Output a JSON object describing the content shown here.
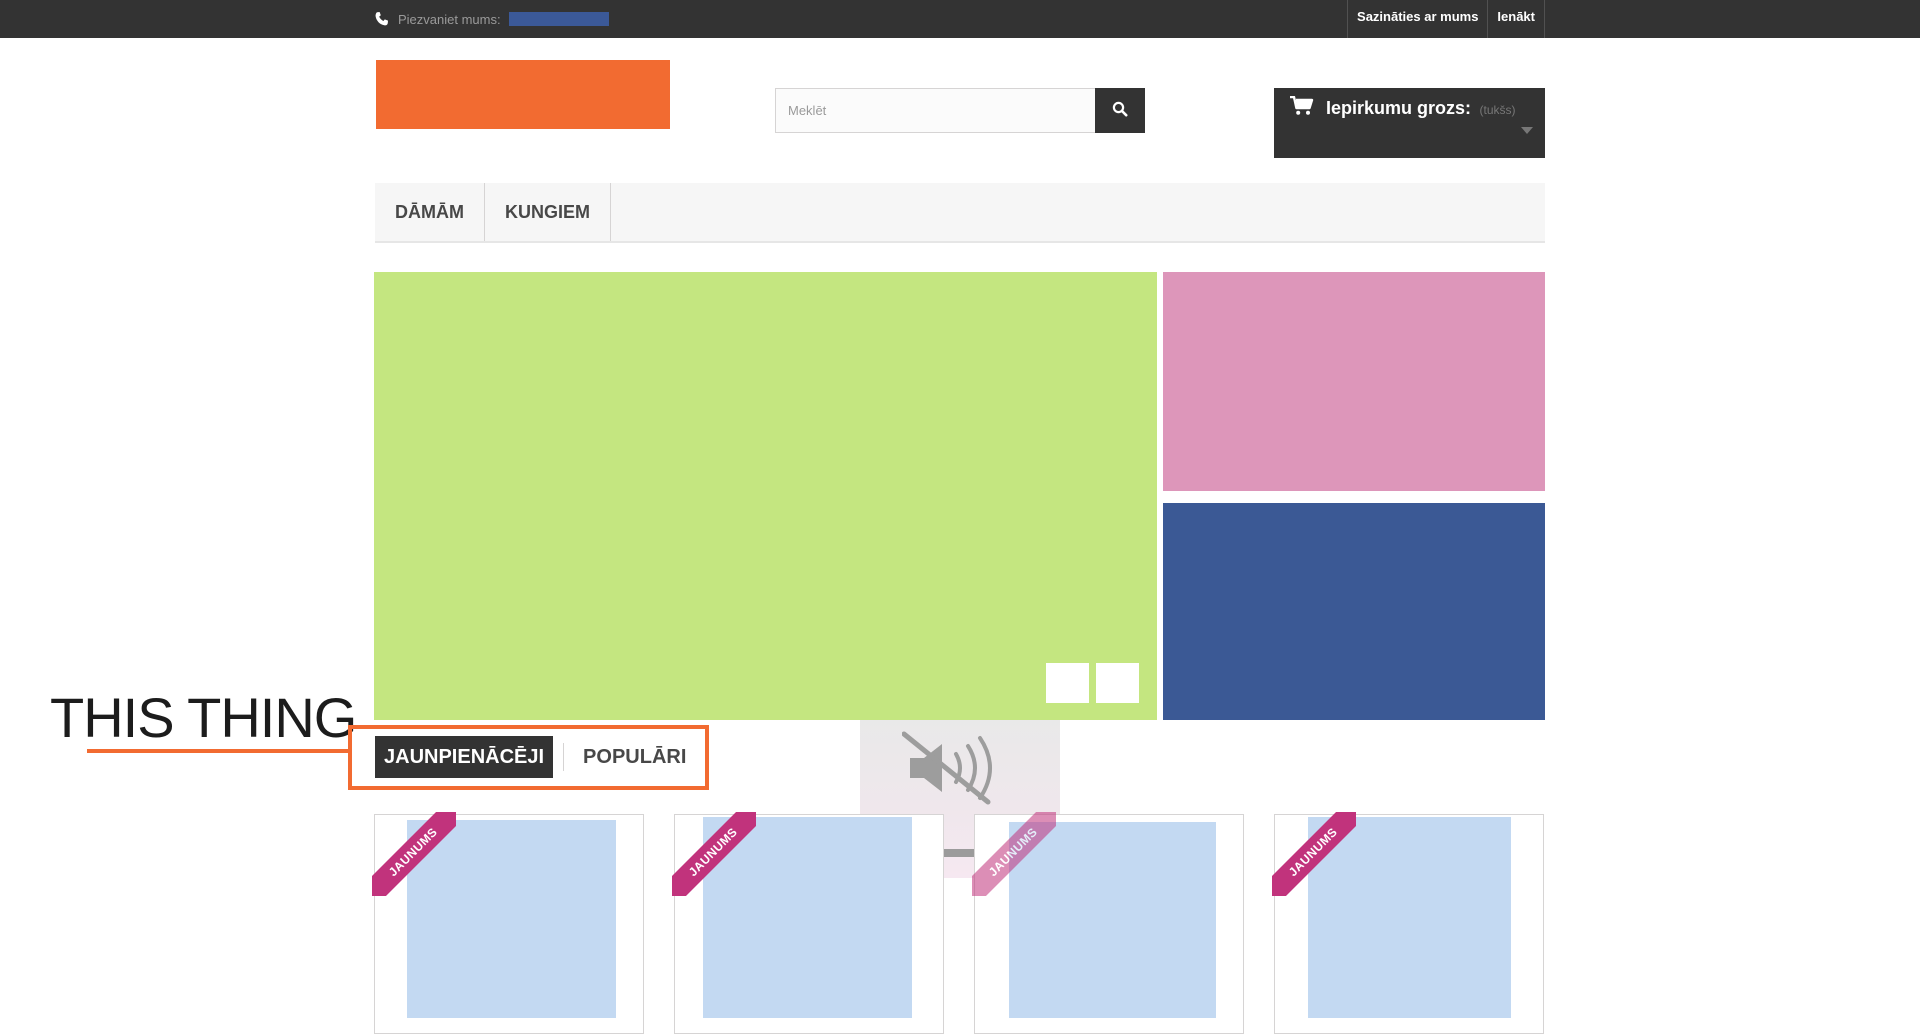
{
  "topbar": {
    "phone_label": "Piezvaniet mums:",
    "links": [
      "Sazināties ar mums",
      "Ienākt"
    ]
  },
  "search": {
    "placeholder": "Meklēt"
  },
  "cart": {
    "label": "Iepirkumu grozs:",
    "status": "(tukšs)"
  },
  "nav": {
    "items": [
      "DĀMĀM",
      "KUNGIEM"
    ]
  },
  "annotation": {
    "text": "THIS THING"
  },
  "tabs": {
    "items": [
      "JAUNPIENĀCĒJI",
      "POPULĀRI"
    ],
    "active": "JAUNPIENĀCĒJI"
  },
  "products": {
    "badge": "JAUNUMS"
  },
  "colors": {
    "dark": "#333333",
    "accent_orange": "#f26b31",
    "slider_green": "#c4e680",
    "banner_pink": "#dd96ba",
    "banner_blue": "#3b5995",
    "product_placeholder": "#c3d9f2",
    "ribbon_magenta": "#c1337c"
  },
  "icons": {
    "phone": "phone-icon",
    "search": "search-icon",
    "cart": "cart-icon",
    "caret": "caret-down-icon",
    "muted": "muted-speaker-icon"
  }
}
